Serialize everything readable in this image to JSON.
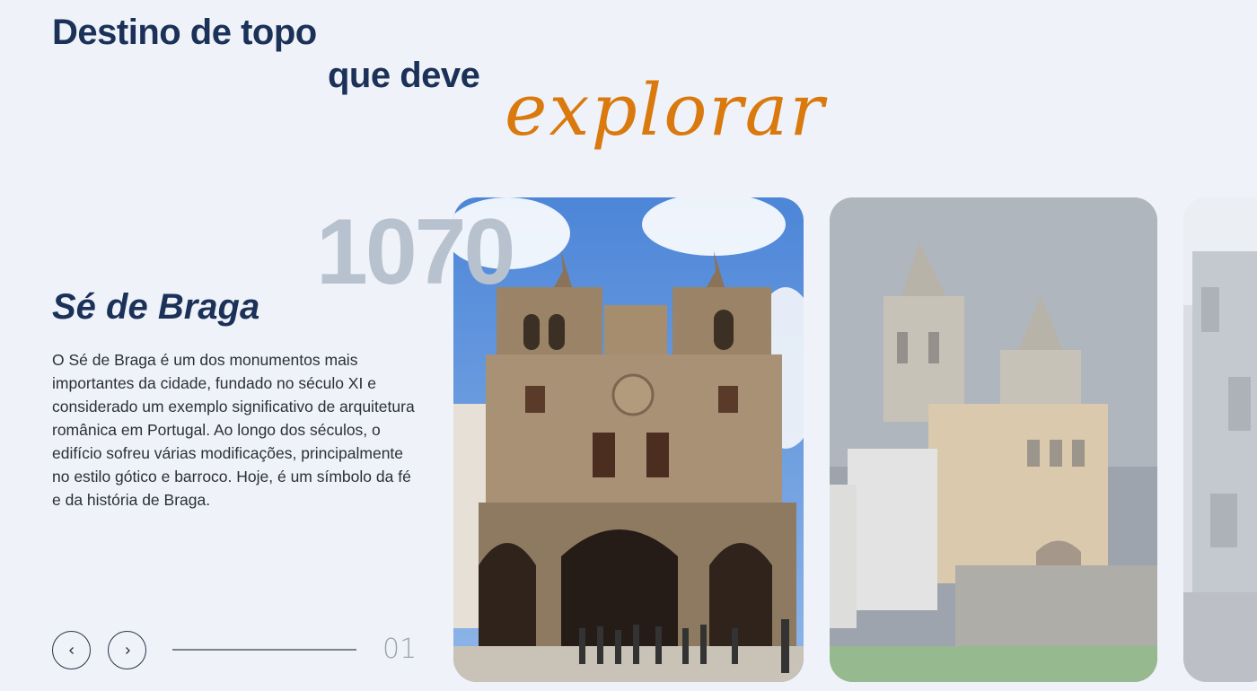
{
  "heading": {
    "line1": "Destino de topo",
    "line2": "que deve",
    "accent": "explorar"
  },
  "featured": {
    "year": "1070",
    "title": "Sé de Braga",
    "description": "O Sé de Braga é um dos monumentos mais importantes da cidade, fundado no século XI e considerado um exemplo significativo de arquitetura românica em Portugal. Ao longo dos séculos, o edifício sofreu várias modificações, principalmente no estilo gótico e barroco. Hoje, é um símbolo da fé e da história de Braga."
  },
  "slider": {
    "prev_icon": "chevron-left-icon",
    "next_icon": "chevron-right-icon",
    "index": "01"
  },
  "colors": {
    "background": "#eff3f9",
    "heading": "#1b3158",
    "accent": "#d9790e",
    "year": "#b8c2cf"
  }
}
